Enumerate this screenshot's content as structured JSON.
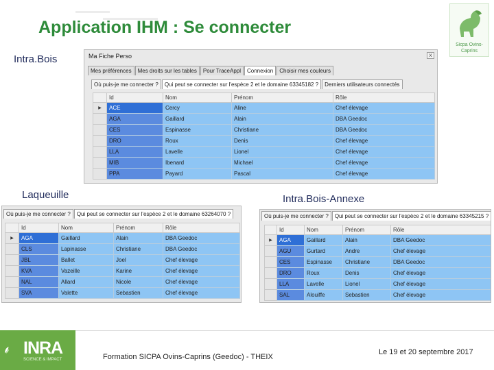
{
  "slide": {
    "title": "Application IHM : Se connecter",
    "labels": {
      "top": "Intra.Bois",
      "left": "Laqueuille",
      "right": "Intra.Bois-Annexe"
    },
    "logo": {
      "text_line1": "Sicpa Ovins-",
      "text_line2": "Caprins",
      "color": "#4f9a4c"
    }
  },
  "window_top": {
    "title": "Ma Fiche Perso",
    "close_label": "x",
    "tabs": [
      "Mes préférences",
      "Mes droits sur les tables",
      "Pour TraceAppl",
      "Connexion",
      "Choisir mes couleurs"
    ],
    "active_tab": 3,
    "subtabs": [
      "Où puis-je me connecter ?",
      "Qui peut se connecter sur l'espèce 2 et le domaine 63345182 ?",
      "Derniers utilisateurs connectés"
    ],
    "columns": [
      "Id",
      "Nom",
      "Prénom",
      "Rôle"
    ],
    "rows": [
      [
        "ACE",
        "Cercy",
        "Aline",
        "Chef élevage"
      ],
      [
        "AGA",
        "Gaillard",
        "Alain",
        "DBA Geedoc"
      ],
      [
        "CES",
        "Espinasse",
        "Christiane",
        "DBA Geedoc"
      ],
      [
        "DRO",
        "Roux",
        "Denis",
        "Chef élevage"
      ],
      [
        "LLA",
        "Lavelle",
        "Lionel",
        "Chef élevage"
      ],
      [
        "MIB",
        "Ibenard",
        "Michael",
        "Chef élevage"
      ],
      [
        "PPA",
        "Payard",
        "Pascal",
        "Chef élevage"
      ]
    ]
  },
  "window_left": {
    "tabs": [
      "Où puis-je me connecter ?",
      "Qui peut se connecter sur l'espèce 2 et le domaine 63264070 ?"
    ],
    "columns": [
      "Id",
      "Nom",
      "Prénom",
      "Rôle"
    ],
    "rows": [
      [
        "AGA",
        "Gaillard",
        "Alain",
        "DBA Geedoc"
      ],
      [
        "CLS",
        "Lapinasse",
        "Christiane",
        "DBA Geedoc"
      ],
      [
        "JBL",
        "Ballet",
        "Joel",
        "Chef élevage"
      ],
      [
        "KVA",
        "Vazeille",
        "Karine",
        "Chef élevage"
      ],
      [
        "NAL",
        "Allard",
        "Nicole",
        "Chef élevage"
      ],
      [
        "SVA",
        "Valette",
        "Sebastien",
        "Chef élevage"
      ]
    ]
  },
  "window_right": {
    "tabs": [
      "Où puis-je me connecter ?",
      "Qui peut se connecter sur l'espèce 2 et le domaine 63345215 ?"
    ],
    "columns": [
      "Id",
      "Nom",
      "Prénom",
      "Rôle"
    ],
    "rows": [
      [
        "AGA",
        "Gaillard",
        "Alain",
        "DBA Geedoc"
      ],
      [
        "AGU",
        "Gurtard",
        "Andre",
        "Chef élevage"
      ],
      [
        "CES",
        "Espinasse",
        "Christiane",
        "DBA Geedoc"
      ],
      [
        "DRO",
        "Roux",
        "Denis",
        "Chef élevage"
      ],
      [
        "LLA",
        "Lavelle",
        "Lionel",
        "Chef élevage"
      ],
      [
        "SAL",
        "Alouiffe",
        "Sebastien",
        "Chef élevage"
      ]
    ]
  },
  "footer": {
    "brand": "INRA",
    "brand_sub": "SCIENCE & IMPACT",
    "center": "Formation SICPA Ovins-Caprins (Geedoc) - THEIX",
    "right": "Le 19 et 20 septembre 2017",
    "brand_color": "#6aab45"
  }
}
